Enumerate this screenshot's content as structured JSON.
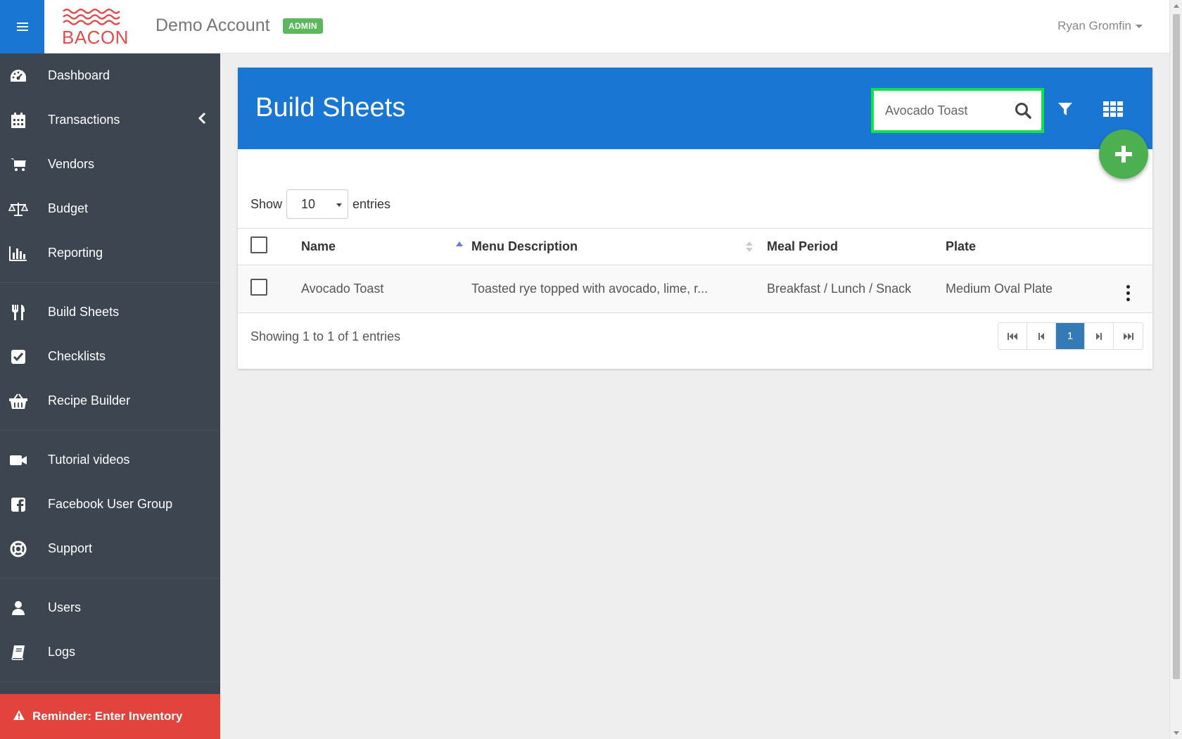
{
  "header": {
    "logo_text": "BACON",
    "account_name": "Demo Account",
    "badge": "ADMIN",
    "user_name": "Ryan Gromfin"
  },
  "sidebar": {
    "groups": [
      [
        {
          "label": "Dashboard",
          "icon": "dashboard-icon"
        },
        {
          "label": "Transactions",
          "icon": "calendar-icon"
        },
        {
          "label": "Vendors",
          "icon": "cart-icon"
        },
        {
          "label": "Budget",
          "icon": "balance-scale-icon"
        },
        {
          "label": "Reporting",
          "icon": "bar-chart-icon"
        }
      ],
      [
        {
          "label": "Build Sheets",
          "icon": "utensils-icon"
        },
        {
          "label": "Checklists",
          "icon": "check-square-icon"
        },
        {
          "label": "Recipe Builder",
          "icon": "basket-icon"
        }
      ],
      [
        {
          "label": "Tutorial videos",
          "icon": "video-camera-icon"
        },
        {
          "label": "Facebook User Group",
          "icon": "facebook-icon"
        },
        {
          "label": "Support",
          "icon": "life-ring-icon"
        }
      ],
      [
        {
          "label": "Users",
          "icon": "user-icon"
        },
        {
          "label": "Logs",
          "icon": "book-icon"
        }
      ]
    ],
    "reminder": "Reminder: Enter Inventory"
  },
  "panel": {
    "title": "Build Sheets",
    "search_value": "Avocado Toast",
    "add_label": "+"
  },
  "table": {
    "show_label": "Show",
    "entries_label": "entries",
    "page_size": "10",
    "columns": [
      "Name",
      "Menu Description",
      "Meal Period",
      "Plate"
    ],
    "rows": [
      {
        "name": "Avocado Toast",
        "description": "Toasted rye topped with avocado, lime, r...",
        "meal_period": "Breakfast / Lunch / Snack",
        "plate": "Medium Oval Plate"
      }
    ],
    "showing_text": "Showing 1 to 1 of 1 entries",
    "current_page": "1"
  },
  "colors": {
    "primary": "#1976d2",
    "sidebar": "#3d4550",
    "reminder": "#e2433d",
    "fab": "#4caf50",
    "badge": "#5cb85c",
    "search_highlight": "#0ee34a"
  }
}
